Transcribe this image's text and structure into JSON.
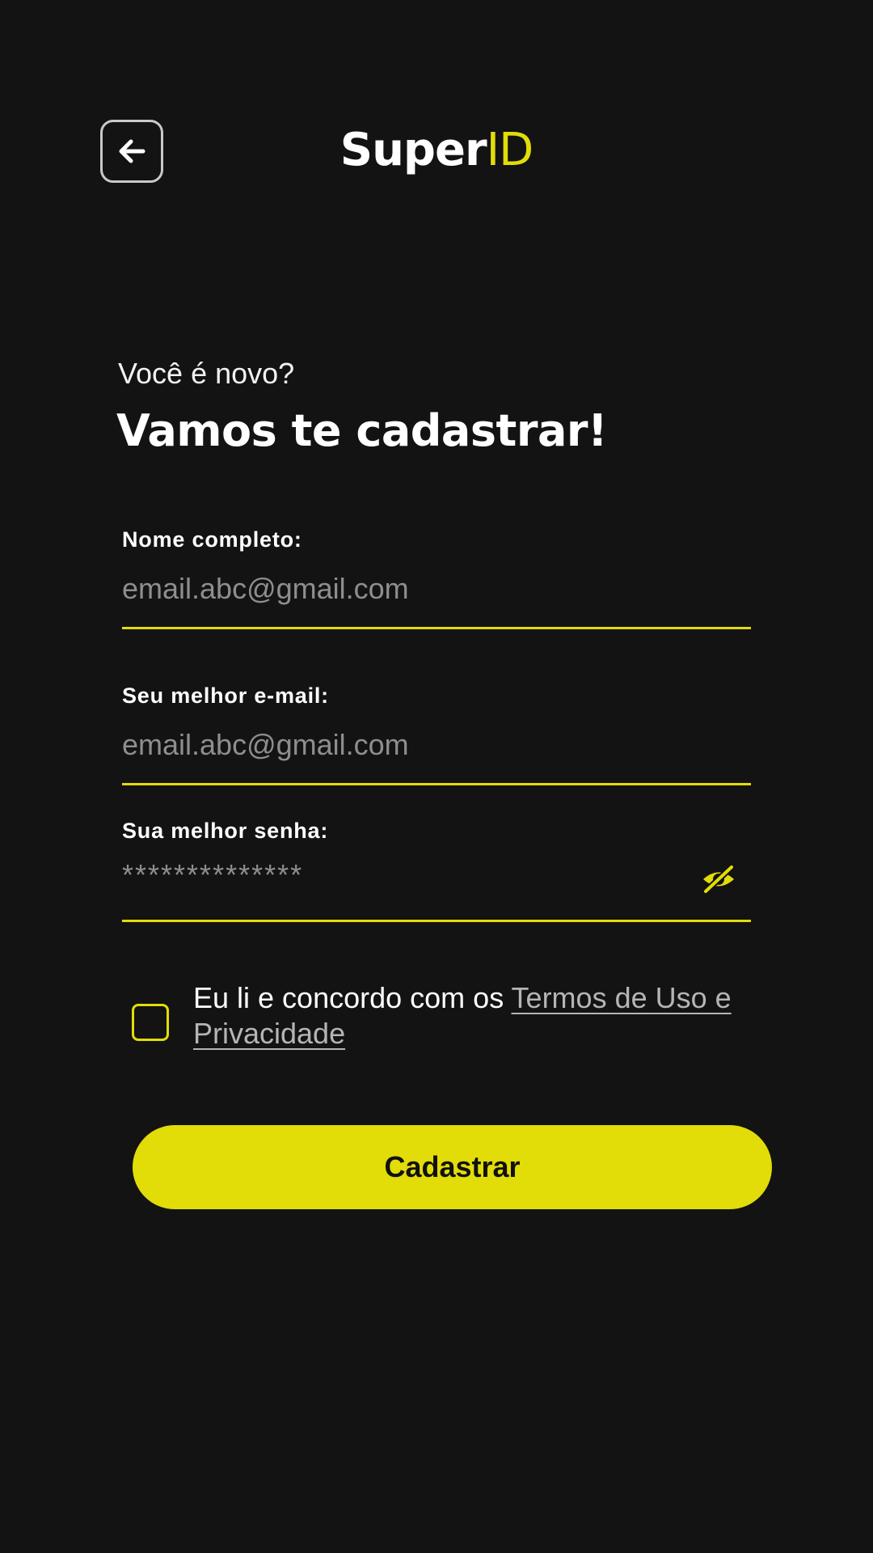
{
  "header": {
    "back_icon": "arrow-left-icon",
    "logo_part1": "Super",
    "logo_part2": "ID"
  },
  "heading": {
    "subtitle": "Você é novo?",
    "title": "Vamos te cadastrar!"
  },
  "form": {
    "name": {
      "label": "Nome completo:",
      "placeholder": "email.abc@gmail.com"
    },
    "email": {
      "label": "Seu melhor e-mail:",
      "placeholder": "email.abc@gmail.com"
    },
    "password": {
      "label": "Sua melhor senha:",
      "placeholder": "**************",
      "toggle_icon": "eye-off-icon"
    },
    "terms": {
      "checked": false,
      "text": "Eu li e concordo com os ",
      "link_text": "Termos de Uso e Privacidade"
    },
    "submit_label": "Cadastrar"
  },
  "colors": {
    "background": "#131313",
    "accent": "#e2dc08",
    "placeholder": "#8e8e8e",
    "link": "#b5b5b5"
  }
}
